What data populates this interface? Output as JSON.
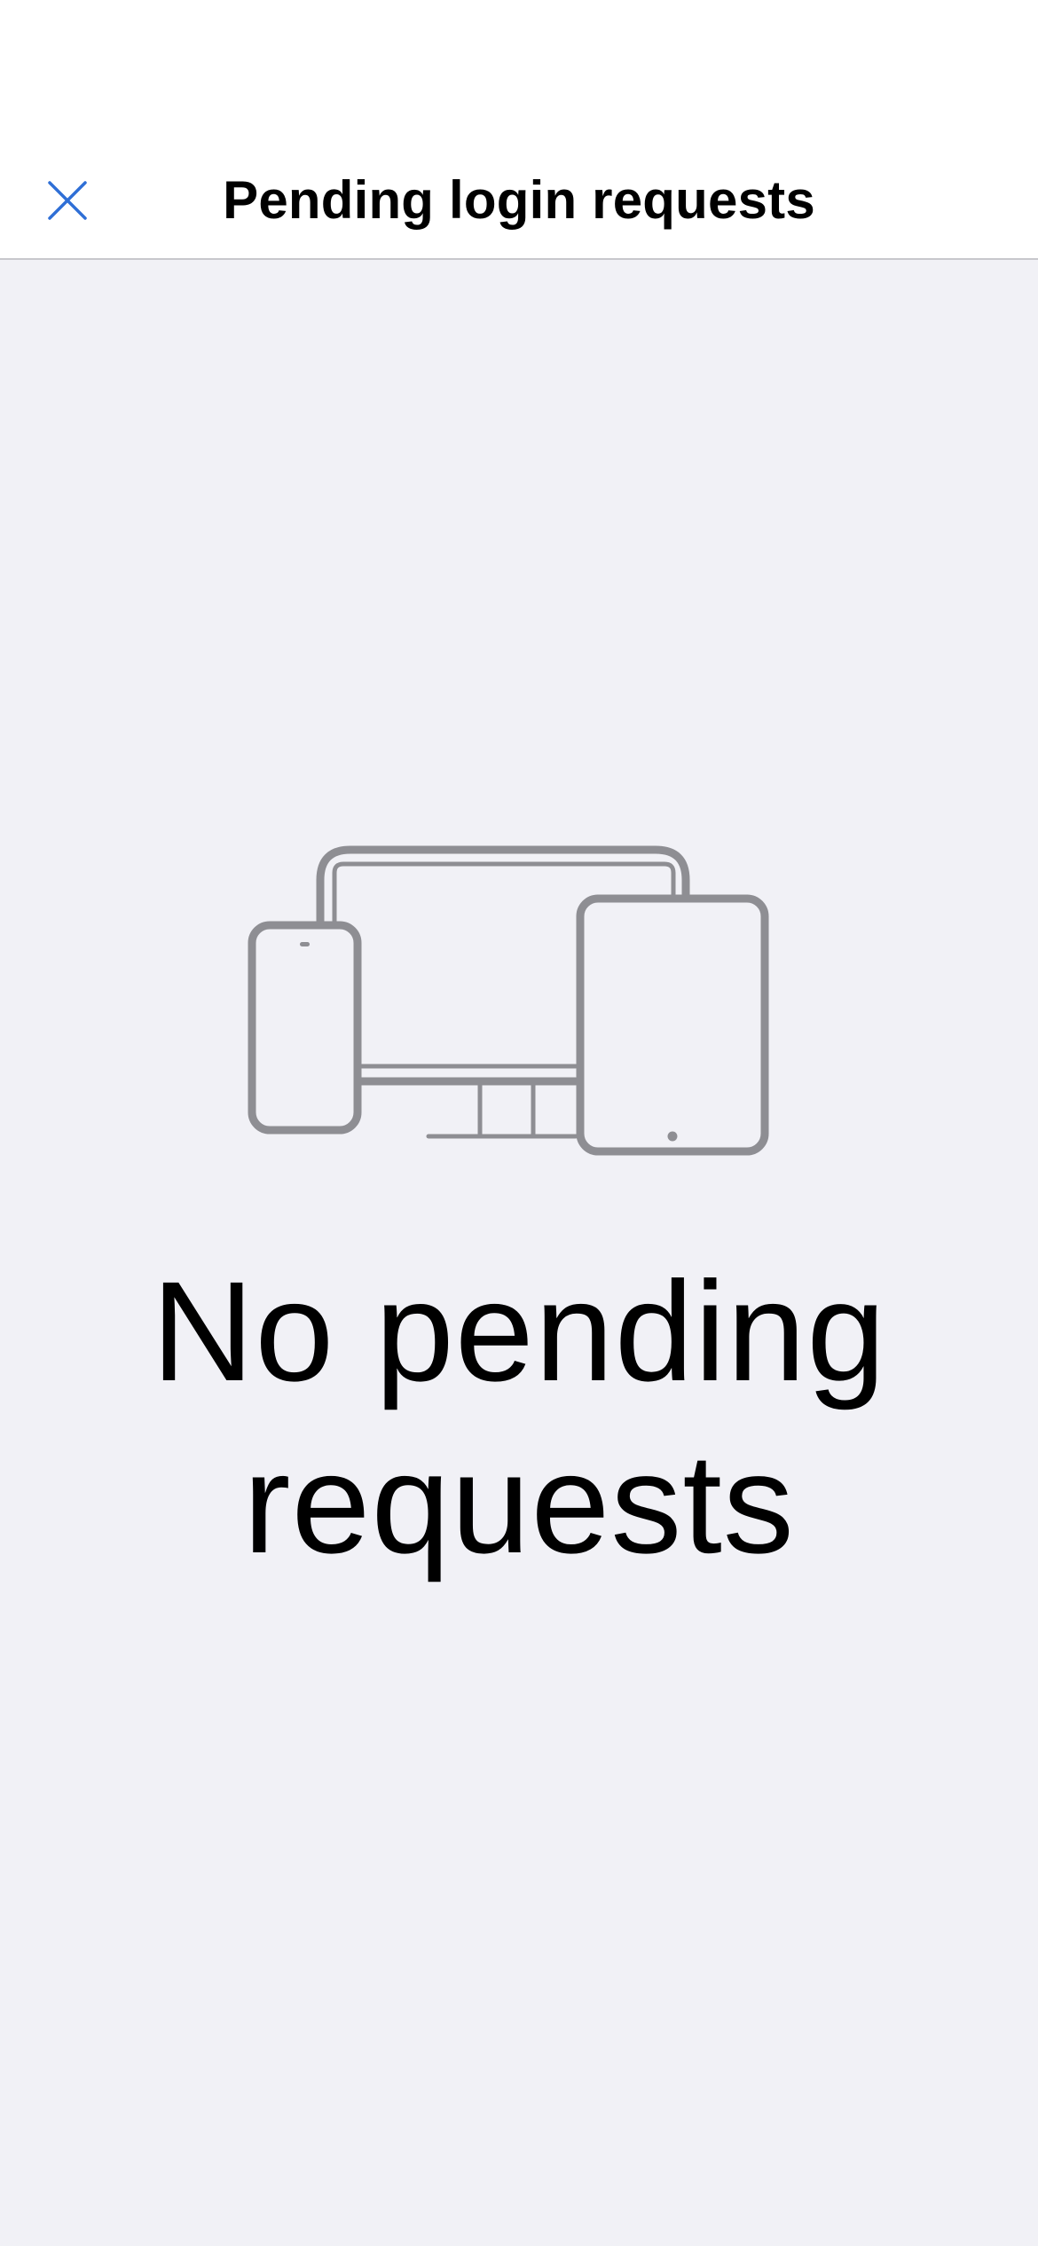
{
  "nav": {
    "title": "Pending login requests",
    "close_icon": "close-icon",
    "accent_color": "#2f6fd6"
  },
  "empty_state": {
    "illustration_icon": "devices-icon",
    "icon_color": "#8e8e93",
    "title": "No pending requests"
  },
  "colors": {
    "background": "#f1f1f6",
    "nav_background": "#ffffff"
  }
}
